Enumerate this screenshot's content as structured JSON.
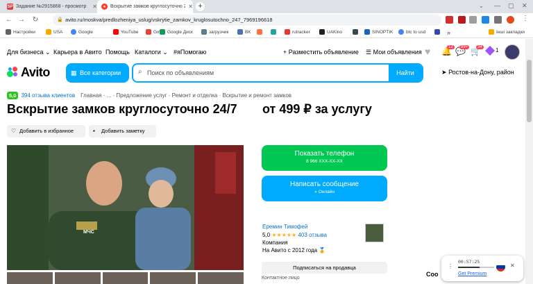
{
  "browser": {
    "tabs": [
      {
        "title": "Задание №2915868 - просмотр",
        "favicon": "SP",
        "active": false
      },
      {
        "title": "Вскрытие замков круглосуточно 2",
        "favicon": "avito",
        "active": true
      }
    ],
    "url": "avito.ru/moskva/predlozheniya_uslug/vskrytie_zamkov_kruglosutochno_247_7969196618",
    "bookmarks": [
      "Настройки",
      "USA",
      "Google",
      "YouTube",
      "Gmail",
      "Google Диск",
      "загрузчик",
      "ВК",
      "",
      "",
      "rutracker",
      "UAKino",
      "",
      "SINOPTIK",
      "btc to usd",
      "",
      "Інші закладки"
    ]
  },
  "header": {
    "nav": [
      "Для бизнеса",
      "Карьера в Авито",
      "Помощь",
      "Каталоги",
      "#яПомогаю"
    ],
    "post_ad": "Разместить объявление",
    "my_ads": "Мои объявления",
    "badges": {
      "notifications": "12",
      "messages": "99+",
      "orders": "34",
      "wallet": "1"
    },
    "logo": "Avito",
    "categories": "Все категории",
    "search_placeholder": "Поиск по объявлениям",
    "find": "Найти",
    "region": "Ростов-на-Дону, район"
  },
  "listing": {
    "rating": "5,0",
    "reviews": "394 отзыва клиентов",
    "breadcrumbs": [
      "Главная",
      "...",
      "Предложение услуг",
      "Ремонт и отделка",
      "Вскрытие и ремонт замков"
    ],
    "title": "Вскрытие замков круглосуточно 24/7",
    "price": "от 499 ₽ за услугу",
    "add_favorite": "Добавить в избранное",
    "add_note": "Добавить заметку",
    "photo_badge": "МЧС"
  },
  "actions": {
    "show_phone": "Показать телефон",
    "phone_mask": "8 966 XXX-XX-XX",
    "write_message": "Написать сообщение",
    "online": "Онлайн"
  },
  "seller": {
    "name": "Еремин Тимофей",
    "rating": "5,0",
    "stars": "★★★★★",
    "reviews": "403 отзыва",
    "type": "Компания",
    "since": "На Авито с 2012 года",
    "subscribe": "Подписаться на продавца",
    "contact_label": "Контактное лицо"
  },
  "popup": {
    "timer": "00:57:25",
    "link": "Get Premium",
    "left_fragment": "Соо"
  },
  "colors": {
    "accent": "#00aaff",
    "green": "#00c853",
    "link": "#0a71c7",
    "rating": "#2ec31e"
  }
}
